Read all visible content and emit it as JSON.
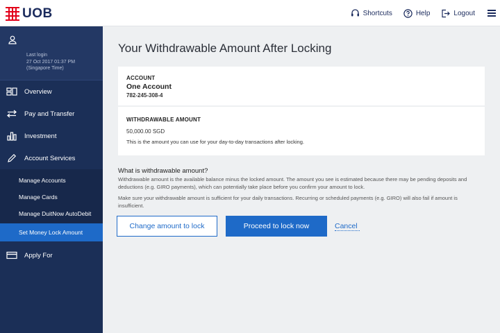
{
  "header": {
    "logo_text": "UOB",
    "shortcuts_label": "Shortcuts",
    "help_label": "Help",
    "logout_label": "Logout"
  },
  "sidebar": {
    "last_login_label": "Last login",
    "last_login_time": "27 Oct 2017 01:37 PM",
    "last_login_zone": "(Singapore Time)",
    "items": [
      {
        "label": "Overview",
        "icon": "overview-icon"
      },
      {
        "label": "Pay and Transfer",
        "icon": "transfer-icon"
      },
      {
        "label": "Investment",
        "icon": "investment-icon"
      },
      {
        "label": "Account Services",
        "icon": "pencil-icon"
      }
    ],
    "sub_items": [
      {
        "label": "Manage Accounts"
      },
      {
        "label": "Manage Cards"
      },
      {
        "label": "Manage DuitNow AutoDebit"
      },
      {
        "label": "Set Money Lock Amount",
        "active": true
      }
    ],
    "apply_label": "Apply For"
  },
  "main": {
    "title": "Your Withdrawable Amount After Locking",
    "account": {
      "label": "ACCOUNT",
      "name": "One Account",
      "number": "782-245-308-4"
    },
    "withdrawable": {
      "label": "WITHDRAWABLE AMOUNT",
      "amount": "50,000.00 SGD",
      "description": "This is the amount you can use for your day-to-day transactions after locking."
    },
    "info": {
      "question": "What is withdrawable amount?",
      "para1": "Withdrawable amount is the available balance minus the locked amount. The amount you see is estimated because there may be pending deposits and deductions (e.g. GIRO payments), which can potentially take place before you confirm your amount to lock.",
      "para2": "Make sure your withdrawable amount is sufficient for your daily transactions. Recurring or scheduled payments (e.g. GIRO) will also fail if amount is insufficient."
    },
    "buttons": {
      "change": "Change amount to lock",
      "proceed": "Proceed to lock now",
      "cancel": "Cancel"
    }
  },
  "colors": {
    "brand_red": "#e2001a",
    "navy": "#1b2f57",
    "accent_blue": "#1e6ac8"
  }
}
